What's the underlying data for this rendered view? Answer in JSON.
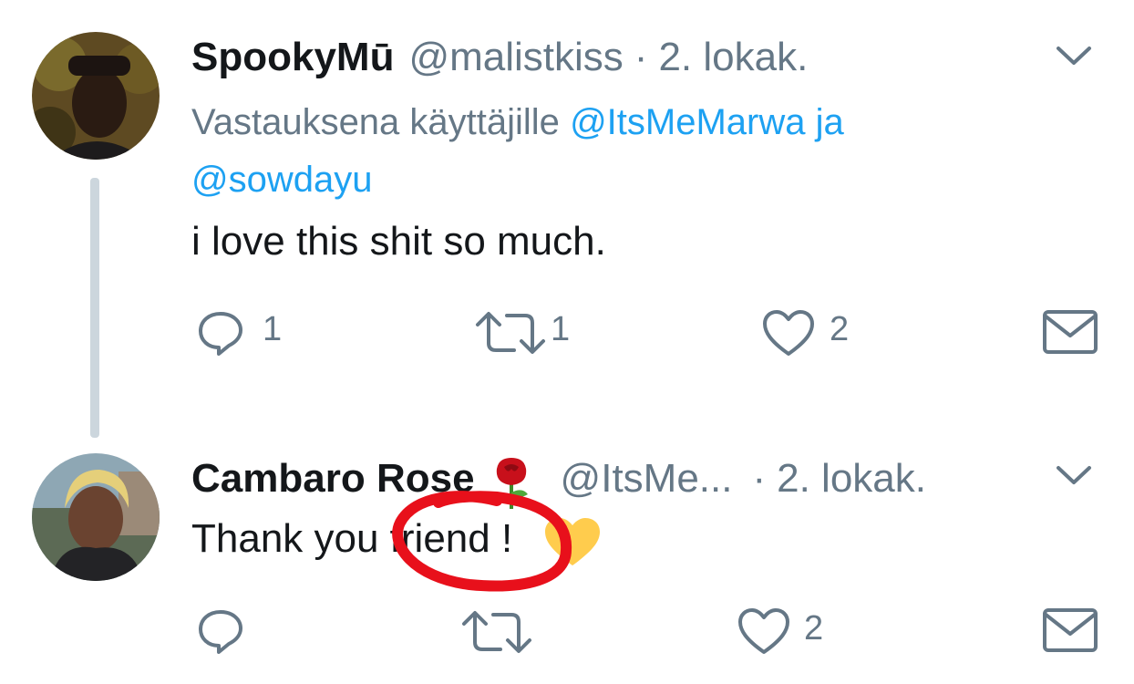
{
  "colors": {
    "text": "#14171a",
    "secondary": "#657786",
    "link": "#1da1f2",
    "thread_line": "#ccd6dd",
    "annotation_circle": "#e8101b",
    "heart_emoji": "#ffcc4d"
  },
  "tweets": [
    {
      "name": "SpookyMū",
      "handle": "@malistkiss",
      "separator": "·",
      "date": "2. lokak.",
      "replying_prefix": "Vastauksena käyttäjille",
      "mention_1": "@ItsMeMarwa",
      "conjunction": "ja",
      "mention_2": "@sowdayu",
      "text": "i love this shit so much.",
      "reply_count": "1",
      "retweet_count": "1",
      "like_count": "2",
      "icons": [
        "avatar",
        "chevron-down-icon",
        "reply-icon",
        "retweet-icon",
        "like-icon",
        "message-icon"
      ]
    },
    {
      "name": "Cambaro Rose",
      "handle": "@ItsMe...",
      "separator": "·",
      "date": "2. lokak.",
      "text": "Thank you friend !",
      "like_count": "2",
      "icons": [
        "avatar",
        "rose-emoji-icon",
        "yellow-heart-emoji-icon",
        "chevron-down-icon",
        "reply-icon",
        "retweet-icon",
        "like-icon",
        "message-icon"
      ]
    }
  ]
}
